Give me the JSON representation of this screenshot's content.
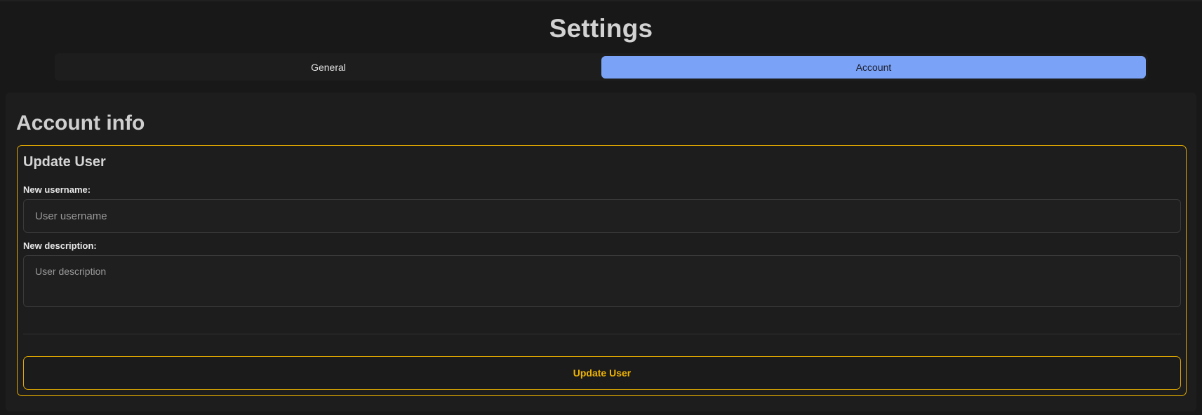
{
  "page": {
    "title": "Settings"
  },
  "tabs": [
    {
      "label": "General",
      "active": false
    },
    {
      "label": "Account",
      "active": true
    }
  ],
  "account": {
    "section_title": "Account info",
    "update_card": {
      "title": "Update User",
      "username_label": "New username:",
      "username_placeholder": "User username",
      "username_value": "",
      "description_label": "New description:",
      "description_placeholder": "User description",
      "description_value": "",
      "submit_label": "Update User"
    }
  },
  "colors": {
    "background": "#181818",
    "panel": "#1d1d1d",
    "active_tab": "#7aa2f7",
    "accent": "#e0a800",
    "accent_text": "#f0b400"
  }
}
